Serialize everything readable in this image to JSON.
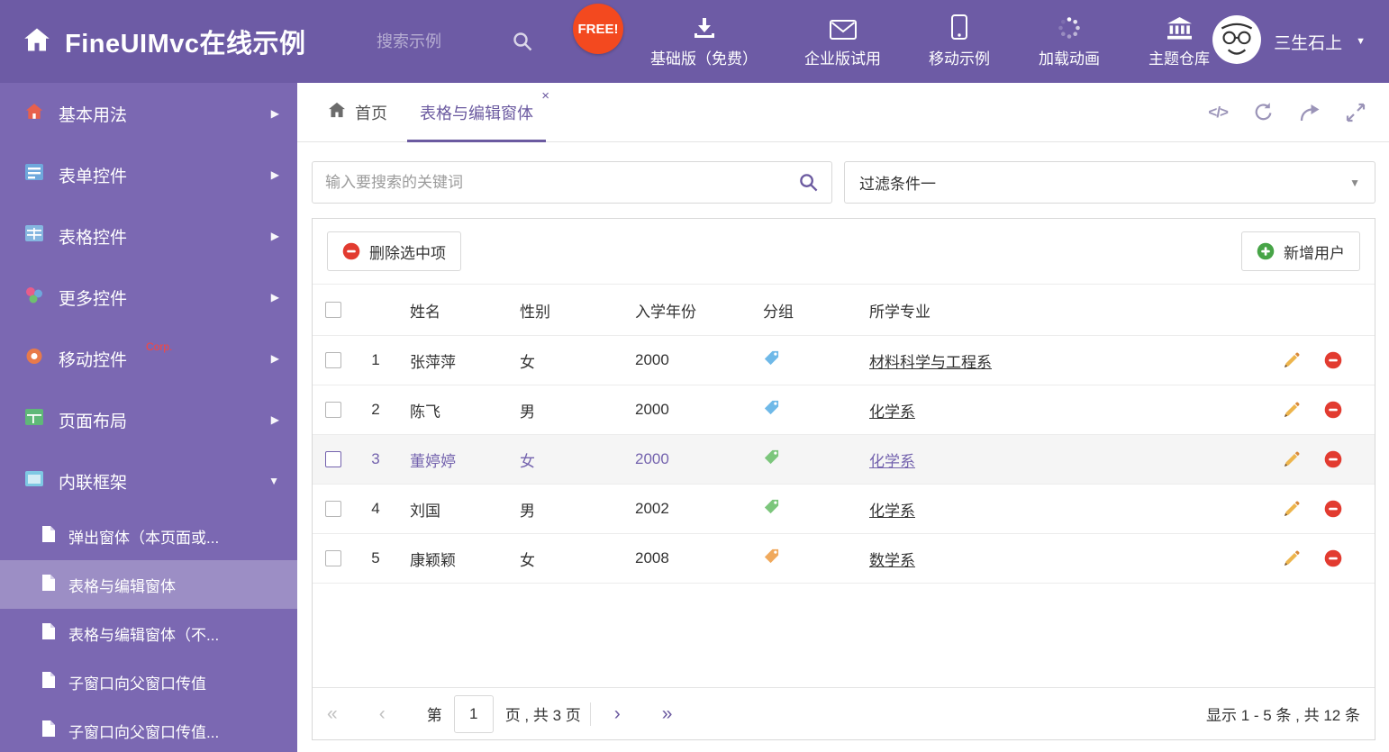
{
  "colors": {
    "header_bg": "#6D5BA5",
    "sidebar_bg": "#7B68B2",
    "accent": "#6B5AA0",
    "free_badge_bg": "#F3491F",
    "corp_red": "#FF4438",
    "tag_blue": "#6FB9E8",
    "tag_green": "#7CC67C",
    "tag_orange": "#F0A95C",
    "delete_red": "#E23B30",
    "add_green": "#47A447",
    "pencil_orange": "#EDB54D",
    "selected_row_bg": "#F5F5F5",
    "selected_row_text": "#7463AE"
  },
  "header": {
    "title": "FineUIMvc在线示例",
    "search_placeholder": "搜索示例",
    "free_badge": "FREE!",
    "nav": [
      {
        "label": "基础版（免费）",
        "icon": "download-icon"
      },
      {
        "label": "企业版试用",
        "icon": "envelope-icon"
      },
      {
        "label": "移动示例",
        "icon": "mobile-icon"
      },
      {
        "label": "加载动画",
        "icon": "spinner-icon"
      },
      {
        "label": "主题仓库",
        "icon": "bank-icon"
      }
    ],
    "user_name": "三生石上"
  },
  "sidebar": {
    "items": [
      {
        "label": "基本用法"
      },
      {
        "label": "表单控件"
      },
      {
        "label": "表格控件"
      },
      {
        "label": "更多控件"
      },
      {
        "label": "移动控件",
        "badge": "Corp."
      },
      {
        "label": "页面布局"
      },
      {
        "label": "内联框架"
      }
    ],
    "children": [
      {
        "label": "弹出窗体（本页面或..."
      },
      {
        "label": "表格与编辑窗体"
      },
      {
        "label": "表格与编辑窗体（不..."
      },
      {
        "label": "子窗口向父窗口传值"
      },
      {
        "label": "子窗口向父窗口传值..."
      }
    ]
  },
  "tabs": {
    "home": "首页",
    "active": "表格与编辑窗体",
    "close_glyph": "×"
  },
  "filter": {
    "search_placeholder": "输入要搜索的关键词",
    "dropdown_value": "过滤条件一"
  },
  "toolbar": {
    "delete_label": "删除选中项",
    "add_label": "新增用户"
  },
  "table": {
    "headers": [
      "姓名",
      "性别",
      "入学年份",
      "分组",
      "所学专业"
    ],
    "rows": [
      {
        "num": "1",
        "name": "张萍萍",
        "gender": "女",
        "year": "2000",
        "tag": "blue",
        "major": "材料科学与工程系"
      },
      {
        "num": "2",
        "name": "陈飞",
        "gender": "男",
        "year": "2000",
        "tag": "blue",
        "major": "化学系"
      },
      {
        "num": "3",
        "name": "董婷婷",
        "gender": "女",
        "year": "2000",
        "tag": "green",
        "major": "化学系",
        "selected": "true"
      },
      {
        "num": "4",
        "name": "刘国",
        "gender": "男",
        "year": "2002",
        "tag": "green",
        "major": "化学系"
      },
      {
        "num": "5",
        "name": "康颖颖",
        "gender": "女",
        "year": "2008",
        "tag": "orange",
        "major": "数学系"
      }
    ]
  },
  "pagination": {
    "first": "«",
    "prev": "‹",
    "next": "›",
    "last": "»",
    "page_label_before": "第",
    "current_page": "1",
    "page_label_after": "页 , 共 3 页",
    "summary": "显示 1 - 5 条 , 共 12 条"
  }
}
